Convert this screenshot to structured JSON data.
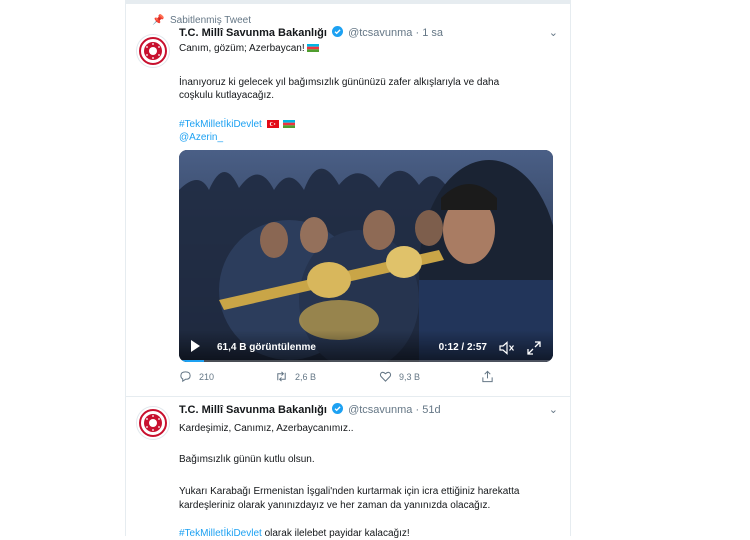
{
  "tweet1": {
    "pinned_label": "Sabitlenmiş Tweet",
    "name": "T.C. Millî Savunma Bakanlığı",
    "handle": "@tcsavunma",
    "dot": "·",
    "time": "1 sa",
    "line1": "Canım, gözüm; Azerbaycan!",
    "line2": "İnanıyoruz ki gelecek yıl bağımsızlık gününüzü zafer alkışlarıyla ve daha",
    "line3": "coşkulu kutlayacağız.",
    "hashtag": "#TekMilletİkiDevlet",
    "mention": "@Azerin_",
    "video": {
      "views": "61,4 B görüntülenme",
      "time": "0:12 / 2:57",
      "progress": 0.068
    },
    "actions": {
      "replies": "210",
      "retweets": "2,6 B",
      "likes": "9,3 B"
    }
  },
  "tweet2": {
    "name": "T.C. Millî Savunma Bakanlığı",
    "handle": "@tcsavunma",
    "dot": "·",
    "time": "51d",
    "line1": "Kardeşimiz, Canımız, Azerbaycanımız..",
    "line2": "Bağımsızlık günün kutlu olsun.",
    "line3": "Yukarı Karabağı Ermenistan İşgali'nden kurtarmak için icra ettiğiniz harekatta",
    "line4": "kardeşleriniz olarak yanınızdayız ve her zaman da yanınızda olacağız.",
    "hashtag": "#TekMilletİkiDevlet",
    "line5_rest": " olarak ilelebet payidar kalacağız!"
  },
  "colors": {
    "link": "#1da1f2",
    "muted": "#657786",
    "border": "#e6ecf0"
  },
  "icons": [
    "pin-icon",
    "verified-badge-icon",
    "chevron-down-icon",
    "azerbaijan-flag-icon",
    "turkey-flag-icon",
    "play-icon",
    "volume-mute-icon",
    "fullscreen-icon",
    "reply-icon",
    "retweet-icon",
    "like-icon",
    "share-icon"
  ]
}
